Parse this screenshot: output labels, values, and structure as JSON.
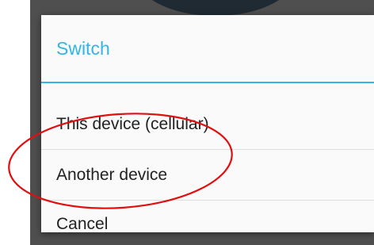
{
  "dialog": {
    "title": "Switch",
    "options": [
      {
        "label": "This device (cellular)"
      },
      {
        "label": "Another device"
      },
      {
        "label": "Cancel"
      }
    ]
  },
  "colors": {
    "accent": "#33b5e5",
    "annotation_circle": "#e01010",
    "backdrop": "#4f4f4f"
  }
}
